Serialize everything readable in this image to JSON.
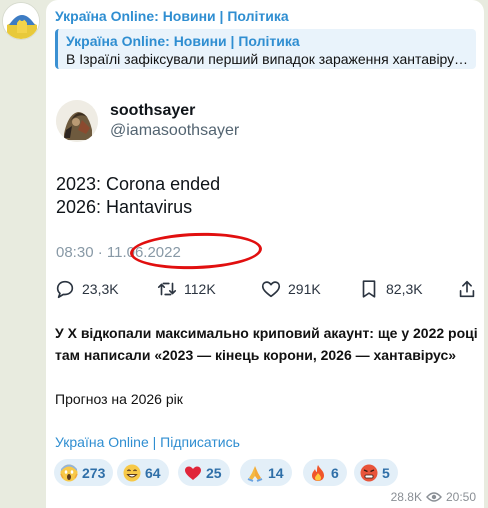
{
  "channel": {
    "name": "Україна Online: Новини | Політика"
  },
  "reply": {
    "title": "Україна Online: Новини | Політика",
    "text": "В Ізраїлі зафіксували перший випадок зараження хантавірусом"
  },
  "tweet": {
    "name": "soothsayer",
    "handle": "@iamasoothsayer",
    "line1": "2023: Corona ended",
    "line2": "2026: Hantavirus",
    "time": "08:30 · 11.06.2022",
    "actions": [
      {
        "icon": "comment-icon",
        "count": "23,3K"
      },
      {
        "icon": "retweet-icon",
        "count": "112K"
      },
      {
        "icon": "heart-icon",
        "count": "291K"
      },
      {
        "icon": "bookmark-icon",
        "count": "82,3K"
      },
      {
        "icon": "share-icon",
        "count": ""
      }
    ]
  },
  "post": {
    "text": "У Х відкопали максимально криповий акаунт: ще у 2022 році там написали «2023 — кінець корони, 2026 — хантавірус»",
    "footer": "Прогноз на 2026 рік",
    "subscribe": "Україна Online | Підписатись"
  },
  "reactions": [
    {
      "icon": "scream-icon",
      "count": "273"
    },
    {
      "icon": "grin-icon",
      "count": "64"
    },
    {
      "icon": "heart-icon",
      "count": "25"
    },
    {
      "icon": "pray-icon",
      "count": "14"
    },
    {
      "icon": "fire-icon",
      "count": "6"
    },
    {
      "icon": "angry-icon",
      "count": "5"
    }
  ],
  "meta": {
    "views": "28.8K",
    "time": "20:50"
  },
  "colors": {
    "link": "#2f8ed1",
    "highlight_circle": "#e10f0f",
    "reaction_bg": "#e3eff8",
    "background": "#e8ebdf"
  }
}
